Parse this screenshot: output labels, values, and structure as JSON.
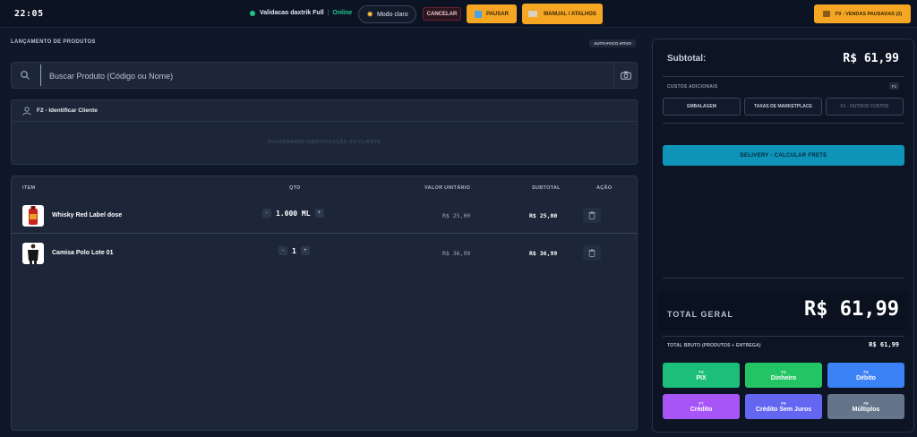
{
  "header": {
    "clock": "22:05",
    "user": "Validacao daxtrik Full",
    "separator": "|",
    "status": "Online",
    "mode_label": "Modo claro",
    "cancel_label": "CANCELAR",
    "pause_label": "PAUSAR",
    "manual_label": "MANUAL / ATALHOS",
    "paused_sales_label": "F9 - VENDAS PAUSADAS (2)"
  },
  "products": {
    "section_title": "LANÇAMENTO DE PRODUTOS",
    "autofocus_badge": "AUTO-FOCO ATIVO",
    "search_placeholder": "Buscar Produto (Código ou Nome)"
  },
  "client": {
    "title": "F2 - Identificar Cliente",
    "waiting": "AGUARDANDO IDENTIFICAÇÃO DO CLIENTE"
  },
  "table": {
    "headers": {
      "item": "ITEM",
      "qty": "QTD",
      "unit": "VALOR UNITÁRIO",
      "subtotal": "SUBTOTAL",
      "action": "AÇÃO"
    },
    "rows": [
      {
        "name": "Whisky Red Label dose",
        "minus": "-",
        "qty": "1.000 ML",
        "plus": "+",
        "unit_price": "R$ 25,00",
        "subtotal": "R$ 25,00"
      },
      {
        "name": "Camisa Polo Lote 01",
        "minus": "-",
        "qty": "1",
        "plus": "+",
        "unit_price": "R$ 36,99",
        "subtotal": "R$ 36,99"
      }
    ]
  },
  "summary": {
    "subtotal_label": "Subtotal:",
    "subtotal_value": "R$ 61,99",
    "costs_title": "CUSTOS ADICIONAIS",
    "costs_shortcut": "F1",
    "cost_buttons": [
      "EMBALAGEM",
      "TAXAS DE MARKETPLACE",
      "F1 - OUTROS CUSTOS"
    ],
    "delivery_label": "DELIVERY - CALCULAR FRETE",
    "total_label": "TOTAL GERAL",
    "total_value": "R$ 61,99",
    "gross_label": "TOTAL BRUTO (PRODUTOS + ENTREGA)",
    "gross_value": "R$ 61,99"
  },
  "payments": [
    {
      "key": "F3",
      "label": "PIX",
      "color": "#1cbf7a"
    },
    {
      "key": "F4",
      "label": "Dinheiro",
      "color": "#22c463"
    },
    {
      "key": "F6",
      "label": "Débito",
      "color": "#3b82f6"
    },
    {
      "key": "F7",
      "label": "Crédito",
      "color": "#a855f7"
    },
    {
      "key": "F9",
      "label": "Crédito Sem Juros",
      "color": "#6366f1"
    },
    {
      "key": "F8",
      "label": "Múltiplos",
      "color": "#64748b"
    }
  ]
}
